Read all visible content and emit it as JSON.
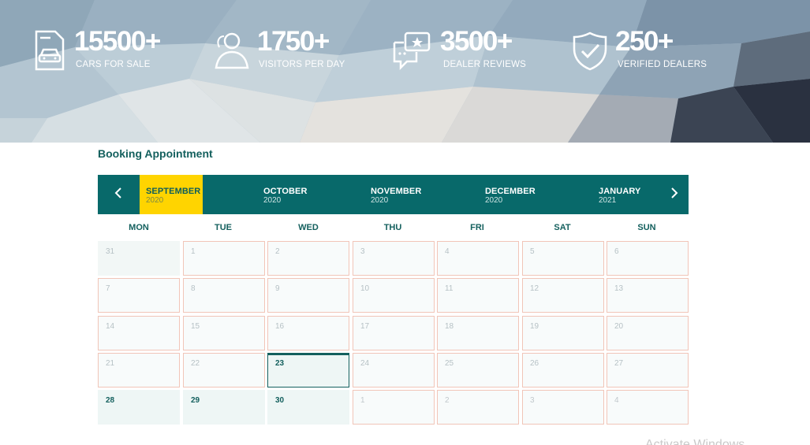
{
  "stats": [
    {
      "number": "15500+",
      "label": "CARS FOR SALE",
      "icon": "car-document-icon"
    },
    {
      "number": "1750+",
      "label": "VISITORS PER DAY",
      "icon": "visitors-icon"
    },
    {
      "number": "3500+",
      "label": "DEALER REVIEWS",
      "icon": "review-chat-icon"
    },
    {
      "number": "250+",
      "label": "VERIFIED DEALERS",
      "icon": "shield-check-icon"
    }
  ],
  "booking": {
    "title": "Booking Appointment",
    "months": [
      {
        "name": "SEPTEMBER",
        "year": "2020",
        "active": true
      },
      {
        "name": "OCTOBER",
        "year": "2020",
        "active": false
      },
      {
        "name": "NOVEMBER",
        "year": "2020",
        "active": false
      },
      {
        "name": "DECEMBER",
        "year": "2020",
        "active": false
      },
      {
        "name": "JANUARY",
        "year": "2021",
        "active": false
      }
    ],
    "weekdays": [
      "MON",
      "TUE",
      "WED",
      "THU",
      "FRI",
      "SAT",
      "SUN"
    ],
    "weeks": [
      [
        {
          "day": "31",
          "state": "outside"
        },
        {
          "day": "1",
          "state": "past"
        },
        {
          "day": "2",
          "state": "past"
        },
        {
          "day": "3",
          "state": "past"
        },
        {
          "day": "4",
          "state": "past"
        },
        {
          "day": "5",
          "state": "past"
        },
        {
          "day": "6",
          "state": "past"
        }
      ],
      [
        {
          "day": "7",
          "state": "past"
        },
        {
          "day": "8",
          "state": "past"
        },
        {
          "day": "9",
          "state": "past"
        },
        {
          "day": "10",
          "state": "past"
        },
        {
          "day": "11",
          "state": "past"
        },
        {
          "day": "12",
          "state": "past"
        },
        {
          "day": "13",
          "state": "past"
        }
      ],
      [
        {
          "day": "14",
          "state": "past"
        },
        {
          "day": "15",
          "state": "past"
        },
        {
          "day": "16",
          "state": "past"
        },
        {
          "day": "17",
          "state": "past"
        },
        {
          "day": "18",
          "state": "past"
        },
        {
          "day": "19",
          "state": "past"
        },
        {
          "day": "20",
          "state": "past"
        }
      ],
      [
        {
          "day": "21",
          "state": "past"
        },
        {
          "day": "22",
          "state": "past"
        },
        {
          "day": "23",
          "state": "today"
        },
        {
          "day": "24",
          "state": "past"
        },
        {
          "day": "25",
          "state": "past"
        },
        {
          "day": "26",
          "state": "past"
        },
        {
          "day": "27",
          "state": "past"
        }
      ],
      [
        {
          "day": "28",
          "state": "avail"
        },
        {
          "day": "29",
          "state": "avail"
        },
        {
          "day": "30",
          "state": "avail"
        },
        {
          "day": "1",
          "state": "next"
        },
        {
          "day": "2",
          "state": "next"
        },
        {
          "day": "3",
          "state": "next"
        },
        {
          "day": "4",
          "state": "next"
        }
      ]
    ]
  },
  "watermark": "Activate Windows",
  "colors": {
    "teal": "#08696a",
    "yellow": "#ffd400",
    "cell_border": "#f1c5b8"
  }
}
